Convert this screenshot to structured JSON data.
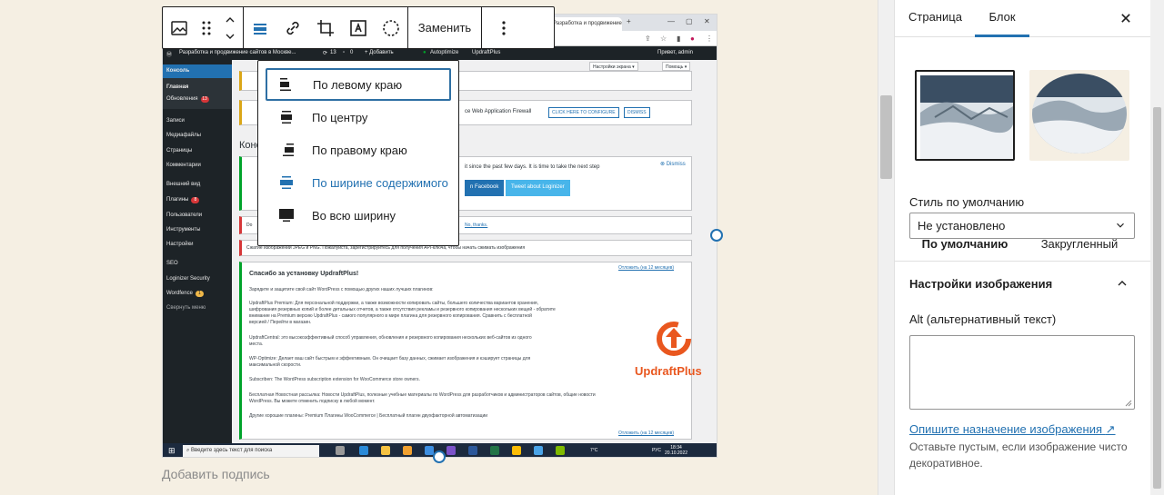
{
  "toolbar": {
    "replace_label": "Заменить",
    "icons": [
      "image-icon",
      "drag-handle-icon",
      "move-up-icon",
      "move-down-icon",
      "align-icon",
      "link-icon",
      "crop-icon",
      "text-overlay-icon",
      "dashed-circle-icon",
      "more-vertical-icon"
    ]
  },
  "align_menu": {
    "items": [
      {
        "label": "По левому краю",
        "icon": "align-left-icon"
      },
      {
        "label": "По центру",
        "icon": "align-center-icon"
      },
      {
        "label": "По правому краю",
        "icon": "align-right-icon"
      },
      {
        "label": "По ширине содержимого",
        "icon": "align-wide-icon"
      },
      {
        "label": "Во всю ширину",
        "icon": "align-full-icon"
      }
    ]
  },
  "caption_placeholder": "Добавить подпись",
  "screenshot": {
    "browser_tab": "Разработка и продвижение сайтов в Москве...",
    "wp_admin_bar": [
      "Разработка и продвижение сайтов в Москве...",
      "13",
      "0",
      "+ Добавить",
      "Autoptimize",
      "UpdraftPlus",
      "Привет, admin"
    ],
    "wp_sidebar": [
      "Консоль",
      "Главная",
      "Обновления",
      "Записи",
      "Медиафайлы",
      "Страницы",
      "Комментарии",
      "Внешний вид",
      "Плагины",
      "Пользователи",
      "Инструменты",
      "Настройки",
      "SEO",
      "Loginizer Security",
      "Wordfence",
      "Свернуть меню"
    ],
    "badges": {
      "updates": "13",
      "plugins": "8",
      "wordfence": "1"
    },
    "screen_options": "Настройки экрана ▾",
    "help_btn": "Помощь ▾",
    "dashboard_title": "Консоль",
    "notice_waf": "ce Web Application Firewall",
    "btn_configure": "CLICK HERE TO CONFIGURE",
    "btn_dismiss": "DISMISS",
    "dismiss_link": "Dismiss",
    "loginizer_text": "it since the past few days. It is time to take the next step",
    "fb_btn": "n Facebook",
    "tw_btn": "Tweet about Loginizer",
    "no_thanks": "No, thanks.",
    "compress_text": "Сжатие изображений JPEG и PNG. Пожалуйста, зарегистрируйтесь для получения API-ключа, чтобы начать сжимать изображения",
    "updraft_title": "Спасибо за установку UpdraftPlus!",
    "updraft_dismiss": "Отложить (на 12 месяцев)",
    "updraft_lines": [
      "Зарядите и защитите свой сайт WordPress с помощью других наших лучших плагинов:",
      "UpdraftPlus Premium: Для персональной поддержки, а также возможности копировать сайты, большего количества вариантов хранения,",
      "шифрования резервных копий и более детальных отчетов, а также отсутствия рекламы и резервного копирования нескольких вещей - обратите",
      "внимание на Premium версию UpdraftPlus - самого популярного в мире плагина для резервного копирования. Сравнить с бесплатной",
      "версией / Перейти в магазин.",
      "UpdraftCentral: это высокоэффективный способ управления, обновления и резервного копирования нескольких веб-сайтов из одного",
      "места.",
      "WP-Optimize: Делает ваш сайт быстрым и эффективным. Он очищает базу данных, сжимает изображения и кэширует страницы для",
      "максимальной скорости.",
      "Subscriben: The WordPress subscription extension for WooCommerce store owners.",
      "Бесплатная Новостная рассылка: Новости UpdraftPlus, полезные учебные материалы по WordPress для разработчиков и администраторов сайтов, общие новости",
      "WordPress. Вы можете отменить подписку в любой момент.",
      "Другие хорошие плагины: Premium Плагины WooCommerce | Бесплатный плагин двухфакторной автоматизации"
    ],
    "updraft_logo_text": "UpdraftPlus",
    "taskbar_search": "Введите здесь текст для поиска",
    "weather": "7°C",
    "lang": "РУС",
    "time": "18:34",
    "date": "20.10.2022"
  },
  "sidebar": {
    "tabs": [
      "Страница",
      "Блок"
    ],
    "active_tab": "Блок",
    "styles_label": "Стили",
    "styles": [
      {
        "label": "По умолчанию",
        "selected": true
      },
      {
        "label": "Закругленный",
        "selected": false
      }
    ],
    "default_style_label": "Стиль по умолчанию",
    "default_style_value": "Не установлено",
    "image_settings_title": "Настройки изображения",
    "alt_label": "Alt (альтернативный текст)",
    "alt_value": "",
    "help_link": "Опишите назначение изображения",
    "help_text": "Оставьте пустым, если изображение чисто декоративное."
  },
  "colors": {
    "accent": "#2271b1",
    "canvas_bg": "#f5efe3",
    "wp_admin_dark": "#1d2327"
  }
}
